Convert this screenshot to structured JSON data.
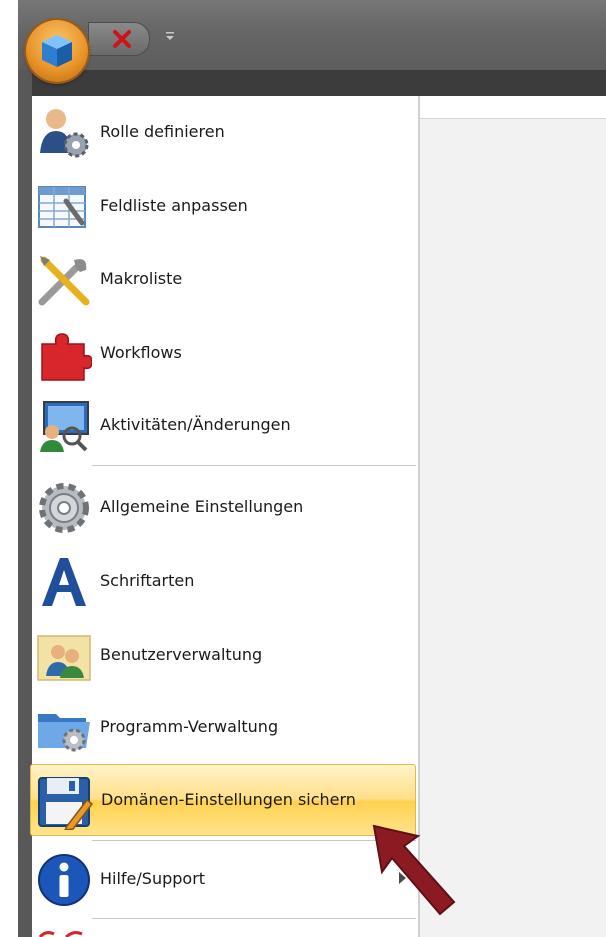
{
  "window": {
    "accent_colors": {
      "orb": "#e9962a",
      "highlight": "#ffd14f",
      "arrow": "#8b1a22"
    }
  },
  "quick_access": {
    "close_icon": "red-x-icon",
    "dropdown_icon": "qat-dropdown-icon"
  },
  "menu": {
    "items": [
      {
        "label": "Rolle definieren",
        "icon": "role-user-gear-icon"
      },
      {
        "label": "Feldliste anpassen",
        "icon": "table-wrench-icon"
      },
      {
        "label": "Makroliste",
        "icon": "tools-icon"
      },
      {
        "label": "Workflows",
        "icon": "puzzle-icon"
      },
      {
        "label": "Aktivitäten/Änderungen",
        "icon": "monitor-user-icon"
      },
      {
        "label": "Allgemeine Einstellungen",
        "icon": "gear-icon"
      },
      {
        "label": "Schriftarten",
        "icon": "font-a-icon"
      },
      {
        "label": "Benutzerverwaltung",
        "icon": "users-icon"
      },
      {
        "label": "Programm-Verwaltung",
        "icon": "folder-gear-icon"
      },
      {
        "label": "Domänen-Einstellungen sichern",
        "icon": "save-disk-icon",
        "highlighted": true
      },
      {
        "label": "Hilfe/Support",
        "icon": "info-icon",
        "has_submenu": true
      }
    ]
  }
}
